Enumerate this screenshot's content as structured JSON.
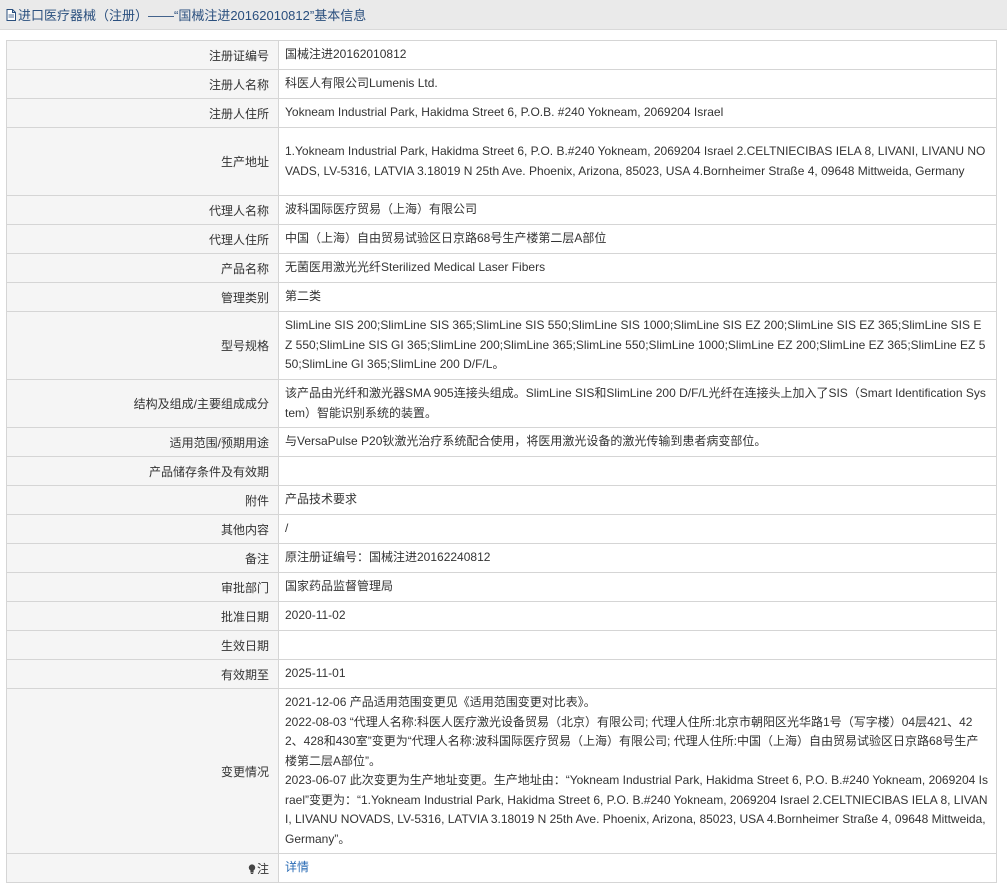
{
  "header": {
    "title": "进口医疗器械（注册）——“国械注进20162010812”基本信息",
    "icon": "document-icon"
  },
  "rows": [
    {
      "label": "注册证编号",
      "value": "国械注进20162010812"
    },
    {
      "label": "注册人名称",
      "value": "科医人有限公司Lumenis Ltd."
    },
    {
      "label": "注册人住所",
      "value": "Yokneam Industrial Park, Hakidma Street 6, P.O.B. #240 Yokneam, 2069204 Israel"
    },
    {
      "label": "生产地址",
      "value": "1.Yokneam Industrial Park, Hakidma Street 6, P.O. B.#240 Yokneam, 2069204 Israel 2.CELTNIECIBAS IELA 8, LIVANI, LIVANU NOVADS, LV-5316, LATVIA 3.18019 N 25th Ave. Phoenix, Arizona, 85023, USA 4.Bornheimer Straße 4, 09648 Mittweida, Germany"
    },
    {
      "label": "代理人名称",
      "value": "波科国际医疗贸易（上海）有限公司"
    },
    {
      "label": "代理人住所",
      "value": "中国（上海）自由贸易试验区日京路68号生产楼第二层A部位"
    },
    {
      "label": "产品名称",
      "value": "无菌医用激光光纤Sterilized Medical Laser Fibers"
    },
    {
      "label": "管理类别",
      "value": "第二类"
    },
    {
      "label": "型号规格",
      "value": "SlimLine SIS 200;SlimLine SIS 365;SlimLine SIS 550;SlimLine SIS 1000;SlimLine SIS EZ 200;SlimLine SIS EZ 365;SlimLine SIS EZ 550;SlimLine SIS GI 365;SlimLine 200;SlimLine 365;SlimLine 550;SlimLine 1000;SlimLine EZ 200;SlimLine EZ 365;SlimLine EZ 550;SlimLine GI 365;SlimLine 200 D/F/L。"
    },
    {
      "label": "结构及组成/主要组成成分",
      "value": "该产品由光纤和激光器SMA 905连接头组成。SlimLine SIS和SlimLine 200 D/F/L光纤在连接头上加入了SIS（Smart Identification System）智能识别系统的装置。"
    },
    {
      "label": "适用范围/预期用途",
      "value": "与VersaPulse P20钬激光治疗系统配合使用，将医用激光设备的激光传输到患者病变部位。"
    },
    {
      "label": "产品储存条件及有效期",
      "value": ""
    },
    {
      "label": "附件",
      "value": "产品技术要求"
    },
    {
      "label": "其他内容",
      "value": "/"
    },
    {
      "label": "备注",
      "value": "原注册证编号：国械注进20162240812"
    },
    {
      "label": "审批部门",
      "value": "国家药品监督管理局"
    },
    {
      "label": "批准日期",
      "value": "2020-11-02"
    },
    {
      "label": "生效日期",
      "value": ""
    },
    {
      "label": "有效期至",
      "value": "2025-11-01"
    }
  ],
  "changes": {
    "label": "变更情况",
    "entries": [
      "2021-12-06 产品适用范围变更见《适用范围变更对比表》。",
      "2022-08-03 “代理人名称:科医人医疗激光设备贸易（北京）有限公司; 代理人住所:北京市朝阳区光华路1号（写字楼）04层421、422、428和430室”变更为“代理人名称:波科国际医疗贸易（上海）有限公司; 代理人住所:中国（上海）自由贸易试验区日京路68号生产楼第二层A部位”。",
      "2023-06-07 此次变更为生产地址变更。生产地址由：“Yokneam Industrial Park, Hakidma Street 6, P.O. B.#240 Yokneam, 2069204 Israel”变更为：“1.Yokneam Industrial Park, Hakidma Street 6, P.O. B.#240 Yokneam, 2069204 Israel 2.CELTNIECIBAS IELA 8, LIVANI, LIVANU NOVADS, LV-5316, LATVIA 3.18019 N 25th Ave. Phoenix, Arizona, 85023, USA 4.Bornheimer Straße 4, 09648 Mittweida, Germany”。"
    ]
  },
  "note": {
    "label": "注",
    "icon": "lightbulb-icon",
    "link": "详情"
  },
  "colors": {
    "title_text": "#2a4f7e",
    "label_bg": "#f5f5f5",
    "border": "#d5d5d5",
    "link": "#2a6bb5"
  }
}
